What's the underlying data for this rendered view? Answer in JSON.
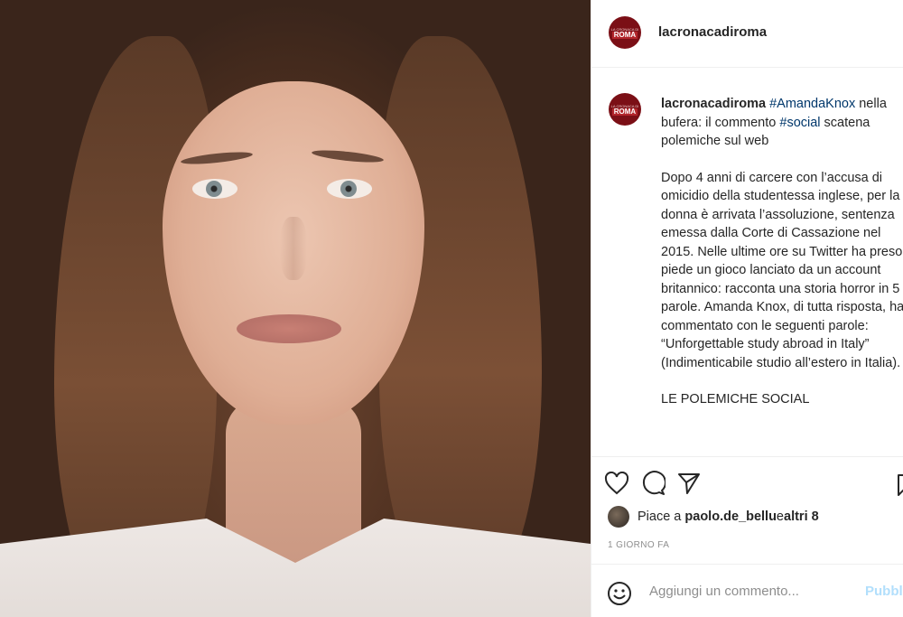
{
  "account": {
    "username": "lacronacadiroma",
    "avatar_top": "LA CRONACA DI",
    "avatar_main": "ROMA",
    "avatar_color": "#7b0f16"
  },
  "caption": {
    "username": "lacronacadiroma",
    "hashtag1": "#AmandaKnox",
    "text1": " nella bufera: il commento ",
    "hashtag2": "#social",
    "text2": " scatena polemiche sul web",
    "paragraph2": "Dopo 4 anni di carcere con l’accusa di omicidio della studentessa inglese, per la donna è arrivata l’assoluzione, sentenza emessa dalla Corte di Cassazione nel 2015. Nelle ultime ore su Twitter ha preso piede un gioco lanciato da un account britannico: racconta una storia horror in 5 parole. Amanda Knox, di tutta risposta, ha commentato con le seguenti parole: “Unforgettable study abroad in Italy” (Indimenticabile studio all’estero in Italia).",
    "paragraph3": "LE POLEMICHE SOCIAL"
  },
  "actions": {
    "icons": [
      "heart-icon",
      "comment-icon",
      "share-icon",
      "bookmark-icon"
    ]
  },
  "likes": {
    "prefix": "Piace a ",
    "user": "paolo.de_bellu",
    "middle": " e ",
    "others": "altri 8"
  },
  "timestamp": "1 GIORNO FA",
  "comment_box": {
    "placeholder": "Aggiungi un commento...",
    "post_label": "Pubblica"
  }
}
